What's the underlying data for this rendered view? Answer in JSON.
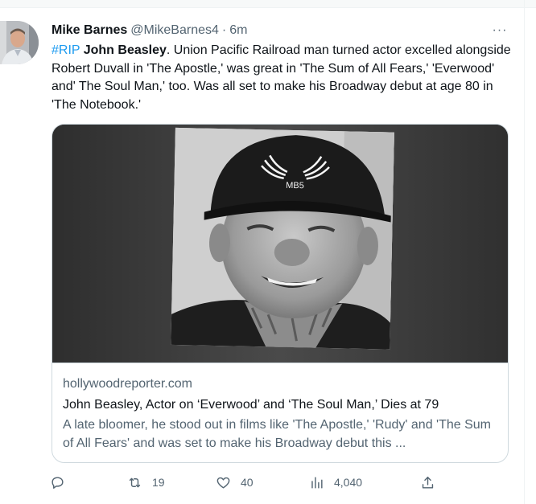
{
  "tweet": {
    "author_name": "Mike Barnes",
    "author_handle": "@MikeBarnes4",
    "separator": "·",
    "time": "6m",
    "more_label": "···",
    "hashtag": "#RIP",
    "bold_name": "John Beasley",
    "body_text": ". Union Pacific Railroad man turned actor excelled alongside Robert Duvall in 'The Apostle,' was great in 'The Sum of All Fears,' 'Everwood' and' The Soul Man,' too. Was all set to make his Broadway debut at age 80 in 'The Notebook.'"
  },
  "card": {
    "domain": "hollywoodreporter.com",
    "title": "John Beasley, Actor on ‘Everwood’ and ‘The Soul Man,’ Dies at 79",
    "description": "A late bloomer, he stood out in films like 'The Apostle,' 'Rudy' and 'The Sum of All Fears' and was set to make his Broadway debut this ...",
    "cap_logo_text": "MB5"
  },
  "actions": {
    "reply": {
      "icon": "reply-icon",
      "count": ""
    },
    "retweet": {
      "icon": "retweet-icon",
      "count": "19"
    },
    "like": {
      "icon": "heart-icon",
      "count": "40"
    },
    "views": {
      "icon": "analytics-icon",
      "count": "4,040"
    },
    "share": {
      "icon": "share-icon",
      "count": ""
    }
  },
  "colors": {
    "link": "#1d9bf0",
    "text": "#0f1419",
    "muted": "#536471",
    "border": "#cfd9de"
  }
}
